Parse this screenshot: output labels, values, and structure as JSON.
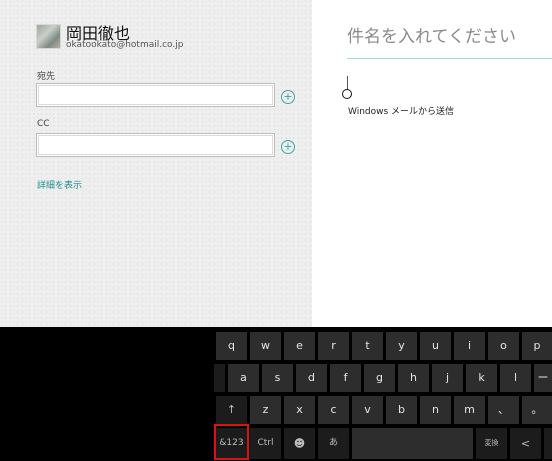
{
  "sender": {
    "name": "岡田徹也",
    "email": "okatookato@hotmail.co.jp"
  },
  "fields": {
    "to_label": "宛先",
    "cc_label": "CC",
    "to_value": "",
    "cc_value": "",
    "add_symbol": "+",
    "details_link": "詳細を表示"
  },
  "compose": {
    "subject_placeholder": "件名を入れてください",
    "signature": "Windows メールから送信"
  },
  "keyboard": {
    "row1": [
      "q",
      "w",
      "e",
      "r",
      "t",
      "y",
      "u",
      "i",
      "o",
      "p"
    ],
    "row2": [
      "a",
      "s",
      "d",
      "f",
      "g",
      "h",
      "j",
      "k",
      "l"
    ],
    "row2_extra": "ー",
    "row3": [
      "z",
      "x",
      "c",
      "v",
      "b",
      "n",
      "m",
      "、",
      "。"
    ],
    "shift": "↑",
    "symbols": "&123",
    "ctrl": "Ctrl",
    "emoji": "☻",
    "ime": "あ",
    "convert": "変換",
    "left_arrow": "<"
  },
  "colors": {
    "accent": "#1f8b8b",
    "highlight": "#e01010"
  }
}
